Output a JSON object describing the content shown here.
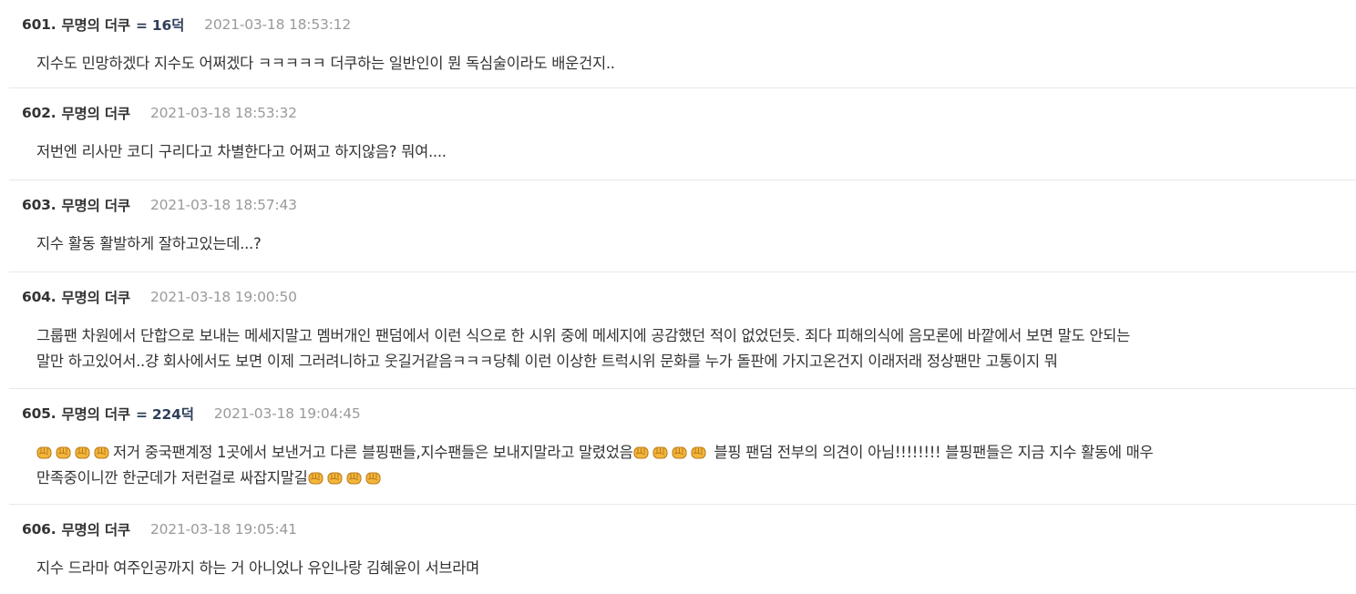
{
  "comments": [
    {
      "number": "601.",
      "author": "무명의 더쿠",
      "duk": "= 16덕",
      "timestamp": "2021-03-18 18:53:12",
      "body": [
        "지수도 민망하겠다 지수도 어쩌겠다 ㅋㅋㅋㅋㅋ 더쿠하는 일반인이 뭔 독심술이라도 배운건지.."
      ]
    },
    {
      "number": "602.",
      "author": "무명의 더쿠",
      "timestamp": "2021-03-18 18:53:32",
      "body": [
        "저번엔 리사만 코디 구리다고 차별한다고 어쩌고 하지않음? 뭐여...."
      ]
    },
    {
      "number": "603.",
      "author": "무명의 더쿠",
      "timestamp": "2021-03-18 18:57:43",
      "body": [
        "지수 활동 활발하게 잘하고있는데...?"
      ]
    },
    {
      "number": "604.",
      "author": "무명의 더쿠",
      "timestamp": "2021-03-18 19:00:50",
      "body": [
        "그룹팬 차원에서 단합으로 보내는 메세지말고 멤버개인 팬덤에서 이런 식으로 한 시위 중에 메세지에 공감했던 적이 없었던듯. 죄다 피해의식에 음모론에 바깥에서 보면 말도 안되는",
        "말만 하고있어서..걍 회사에서도 보면 이제 그러려니하고 웃길거같음ㅋㅋㅋ당췌 이런 이상한 트럭시위 문화를 누가 돌판에 가지고온건지 이래저래 정상팬만 고통이지 뭐"
      ]
    },
    {
      "number": "605.",
      "author": "무명의 더쿠",
      "duk": "= 224덕",
      "timestamp": "2021-03-18 19:04:45",
      "body_segments": [
        "저거 중국팬계정 1곳에서 보낸거고 다른 블핑팬들,지수팬들은 보내지말라고 말렸었음",
        " 블핑 팬덤 전부의 의견이 아님!!!!!!!! 블핑팬들은 지금 지수 활동에 매우",
        "만족중이니깐 한군데가 저런걸로 싸잡지말길"
      ],
      "emoji": "oncoming-fist-emoji",
      "emoji_color": "#f2b63a"
    },
    {
      "number": "606.",
      "author": "무명의 더쿠",
      "timestamp": "2021-03-18 19:05:41",
      "body": [
        "지수 드라마 여주인공까지 하는 거 아니었나 유인나랑 김혜윤이 서브라며"
      ]
    }
  ]
}
